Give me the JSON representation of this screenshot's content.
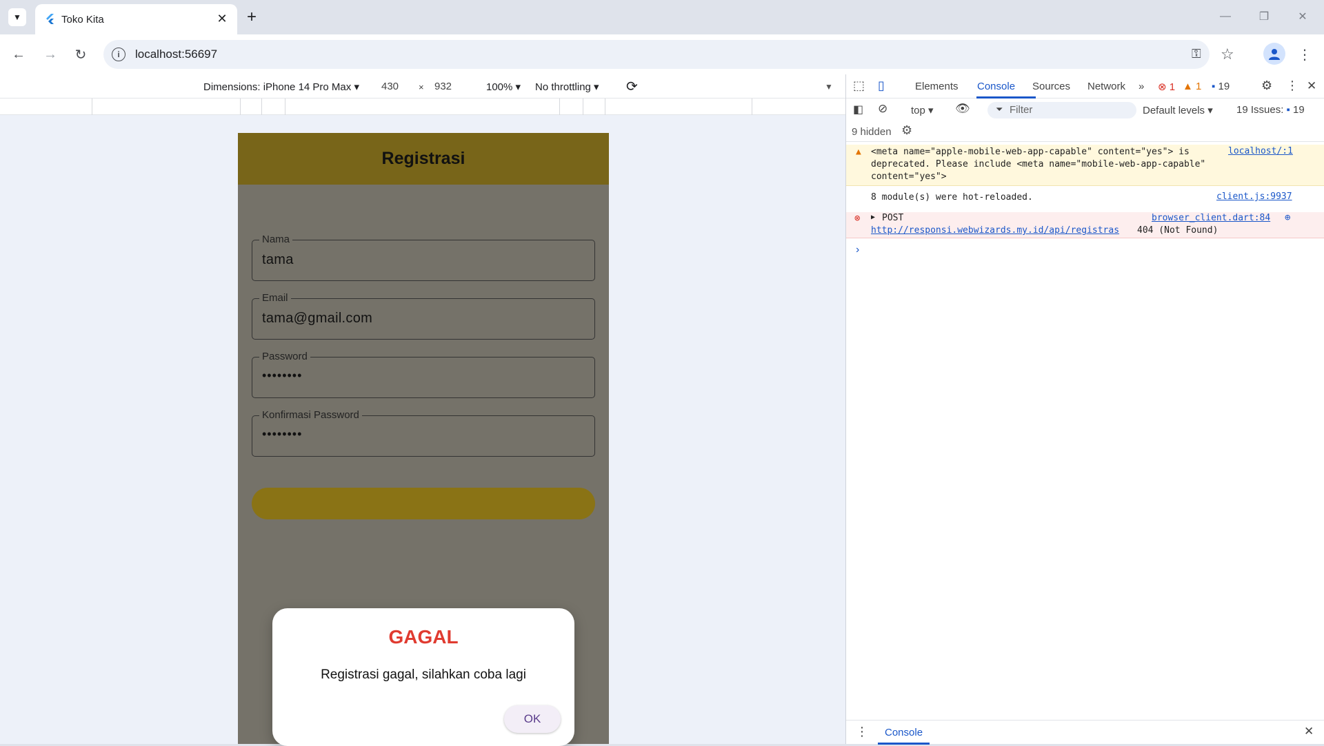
{
  "browser": {
    "tab_title": "Toko Kita",
    "url": "localhost:56697"
  },
  "device_toolbar": {
    "dimensions_label": "Dimensions: iPhone 14 Pro Max",
    "width": "430",
    "times": "×",
    "height": "932",
    "zoom": "100%",
    "throttling": "No throttling"
  },
  "app": {
    "title": "Registrasi",
    "fields": [
      {
        "label": "Nama",
        "value": "tama"
      },
      {
        "label": "Email",
        "value": "tama@gmail.com"
      },
      {
        "label": "Password",
        "value": "••••••••"
      },
      {
        "label": "Konfirmasi Password",
        "value": "••••••••"
      }
    ],
    "dialog": {
      "title": "GAGAL",
      "message": "Registrasi gagal, silahkan coba lagi",
      "ok_label": "OK"
    }
  },
  "devtools": {
    "tabs": [
      "Elements",
      "Console",
      "Sources",
      "Network"
    ],
    "error_count": "1",
    "warning_count": "1",
    "message_count": "19",
    "context": "top",
    "filter_placeholder": "Filter",
    "levels": "Default levels",
    "issues_label": "19 Issues:",
    "issues_count": "19",
    "hidden_label": "9 hidden",
    "messages": [
      {
        "level": "warning",
        "text": "<meta name=\"apple-mobile-web-app-capable\" content=\"yes\"> is\ndeprecated. Please include <meta name=\"mobile-web-app-capable\"\ncontent=\"yes\">",
        "source": "localhost/:1"
      },
      {
        "level": "info",
        "text": "8 module(s) were hot-reloaded.",
        "source": "client.js:9937"
      },
      {
        "level": "error",
        "method": "POST",
        "url": "http://responsi.webwizards.my.id/api/registras",
        "status": "404 (Not Found)",
        "source": "browser_client.dart:84"
      }
    ],
    "drawer_tab": "Console"
  },
  "colors": {
    "app_bar": "#786519",
    "dialog_title": "#e03b30",
    "devtools_accent": "#1a57c9"
  }
}
